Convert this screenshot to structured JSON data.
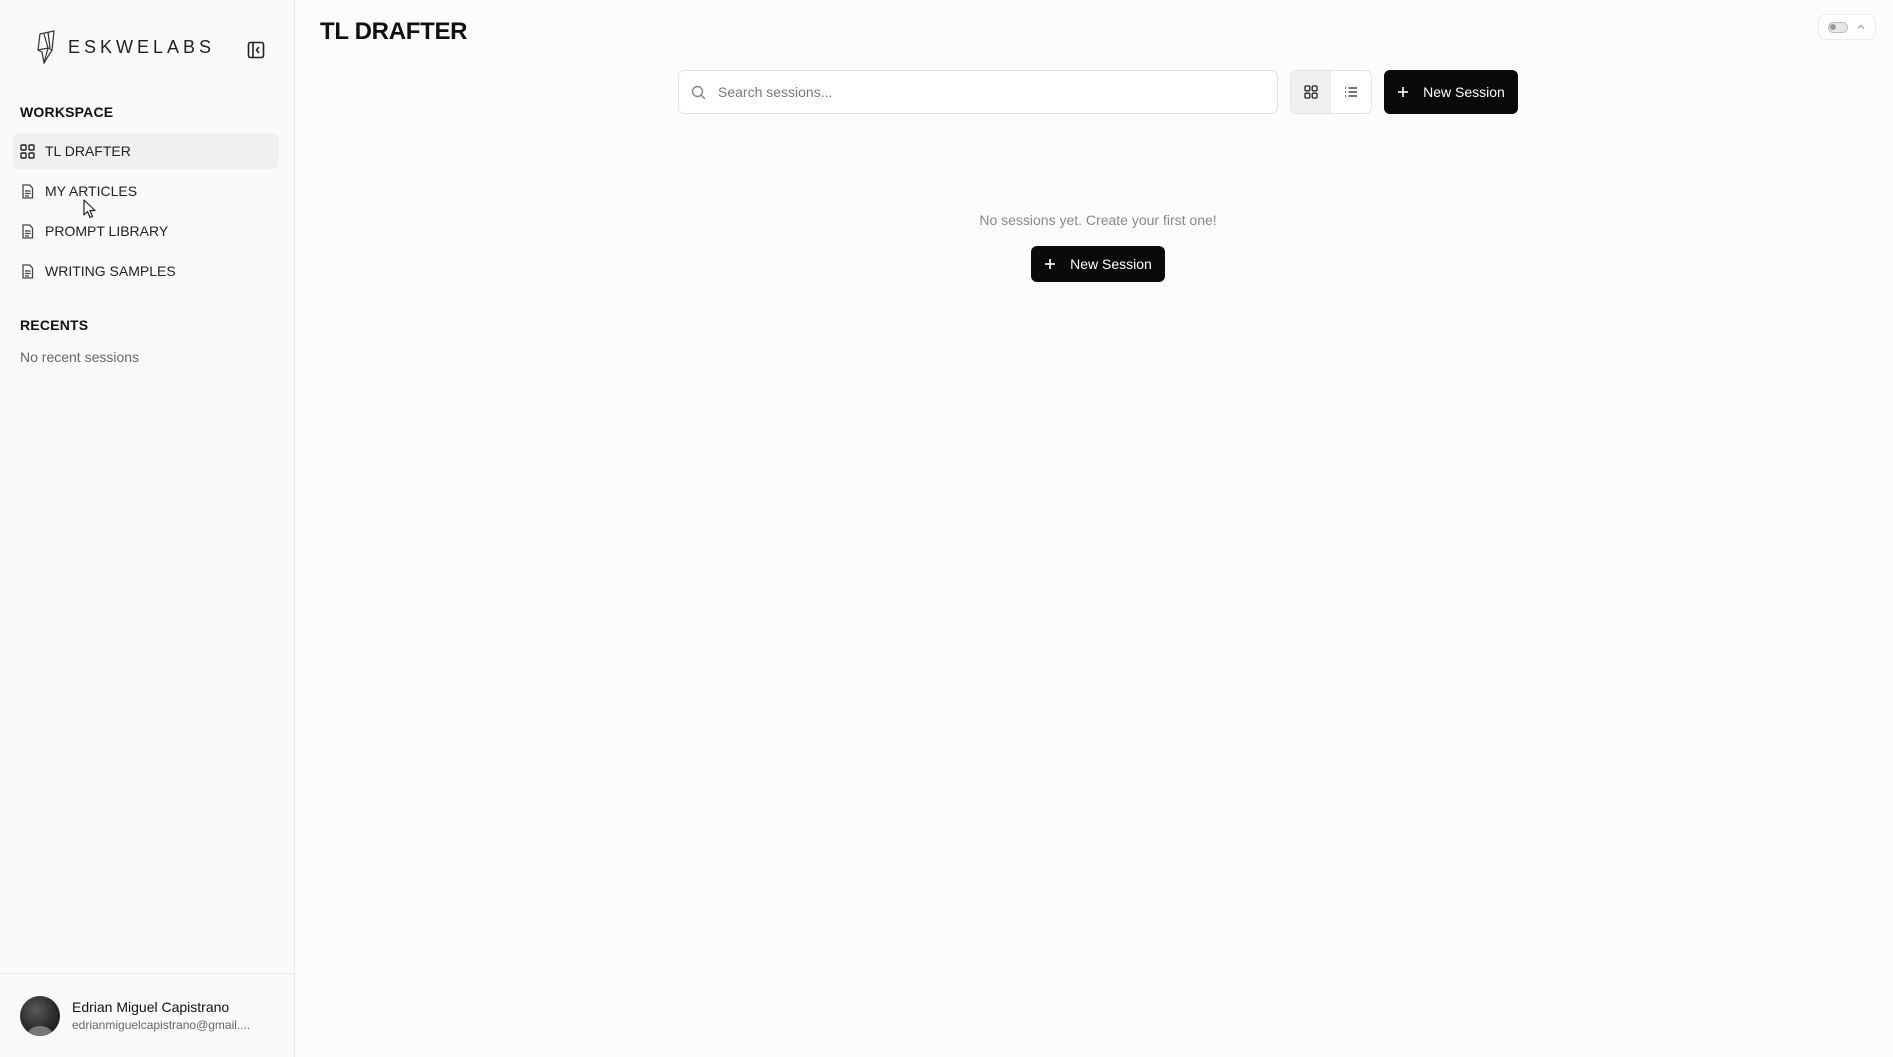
{
  "brand": {
    "name": "ESKWELABS"
  },
  "sidebar": {
    "workspace_title": "WORKSPACE",
    "items": [
      {
        "label": "TL DRAFTER",
        "icon": "grid-icon",
        "active": true
      },
      {
        "label": "MY ARTICLES",
        "icon": "document-icon",
        "active": false
      },
      {
        "label": "PROMPT LIBRARY",
        "icon": "document-icon",
        "active": false
      },
      {
        "label": "WRITING SAMPLES",
        "icon": "document-icon",
        "active": false
      }
    ],
    "recents_title": "RECENTS",
    "recents_empty": "No recent sessions"
  },
  "user": {
    "name": "Edrian Miguel Capistrano",
    "email": "edrianmiguelcapistrano@gmail...."
  },
  "main": {
    "title": "TL DRAFTER",
    "search_placeholder": "Search sessions...",
    "new_session_label": "New Session",
    "empty_message": "No sessions yet. Create your first one!",
    "empty_new_session_label": "New Session"
  },
  "colors": {
    "primary_button": "#0a0a0a",
    "active_nav_bg": "#f0f0f0",
    "sidebar_bg": "#fafafa"
  }
}
